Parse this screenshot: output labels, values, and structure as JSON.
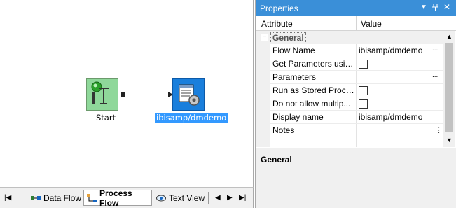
{
  "canvas": {
    "nodes": {
      "start_label": "Start",
      "datasource_label": "ibisamp/dmdemo"
    }
  },
  "tabs": {
    "data_flow": "Data Flow",
    "process_flow": "Process Flow",
    "text_view": "Text View"
  },
  "properties": {
    "title": "Properties",
    "columns": {
      "attribute": "Attribute",
      "value": "Value"
    },
    "category": "General",
    "rows": [
      {
        "name": "Flow Name",
        "value": "ibisamp/dmdemo"
      },
      {
        "name": "Get Parameters usin...",
        "value": ""
      },
      {
        "name": "Parameters",
        "value": ""
      },
      {
        "name": "Run as Stored Proce...",
        "value": ""
      },
      {
        "name": "Do not allow multip...",
        "value": ""
      },
      {
        "name": "Display name",
        "value": "ibisamp/dmdemo"
      },
      {
        "name": "Notes",
        "value": ""
      }
    ],
    "description_title": "General"
  }
}
